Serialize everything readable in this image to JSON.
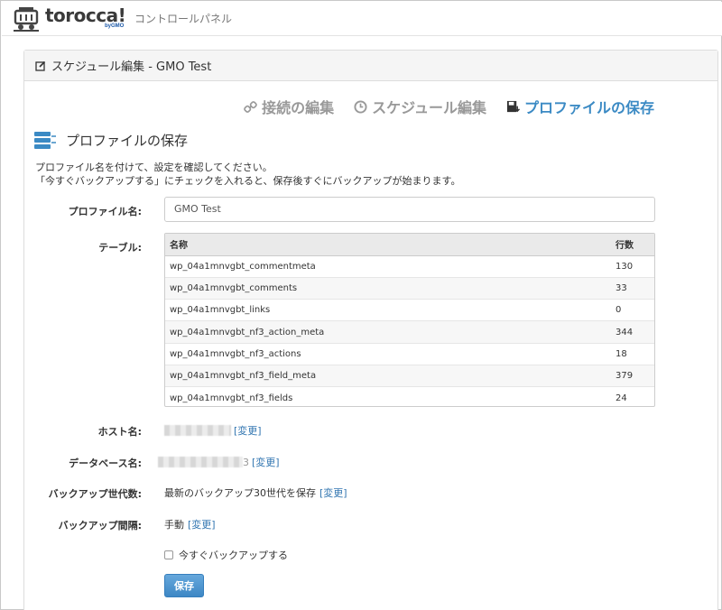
{
  "header": {
    "logo_text": "torocca!",
    "logo_sub": "byGMO",
    "app_title": "コントロールパネル"
  },
  "panel": {
    "title": "スケジュール編集 - GMO Test"
  },
  "steps": [
    {
      "label": "接続の編集",
      "icon": "link-icon"
    },
    {
      "label": "スケジュール編集",
      "icon": "clock-icon"
    },
    {
      "label": "プロファイルの保存",
      "icon": "save-icon"
    }
  ],
  "section": {
    "title": "プロファイルの保存",
    "desc_line1": "プロファイル名を付けて、設定を確認してください。",
    "desc_line2": "「今すぐバックアップする」にチェックを入れると、保存後すぐにバックアップが始まります。"
  },
  "form": {
    "profile_label": "プロファイル名:",
    "profile_value": "GMO Test",
    "table_label": "テーブル:",
    "table_headers": {
      "name": "名称",
      "rows": "行数"
    },
    "table_rows": [
      {
        "name": "wp_04a1mnvgbt_commentmeta",
        "rows": "130"
      },
      {
        "name": "wp_04a1mnvgbt_comments",
        "rows": "33"
      },
      {
        "name": "wp_04a1mnvgbt_links",
        "rows": "0"
      },
      {
        "name": "wp_04a1mnvgbt_nf3_action_meta",
        "rows": "344"
      },
      {
        "name": "wp_04a1mnvgbt_nf3_actions",
        "rows": "18"
      },
      {
        "name": "wp_04a1mnvgbt_nf3_field_meta",
        "rows": "379"
      },
      {
        "name": "wp_04a1mnvgbt_nf3_fields",
        "rows": "24"
      }
    ],
    "host_label": "ホスト名:",
    "host_change": "[変更]",
    "db_label": "データベース名:",
    "db_tail": "3",
    "db_change": "[変更]",
    "gen_label": "バックアップ世代数:",
    "gen_value": "最新のバックアップ30世代を保存",
    "gen_change": "[変更]",
    "interval_label": "バックアップ間隔:",
    "interval_value": "手動",
    "interval_change": "[変更]",
    "backup_now_label": "今すぐバックアップする",
    "save_button": "保存"
  },
  "colors": {
    "accent": "#3b8ac4",
    "link": "#3276b1",
    "muted_step": "#999999",
    "button": "#3d87c5"
  }
}
